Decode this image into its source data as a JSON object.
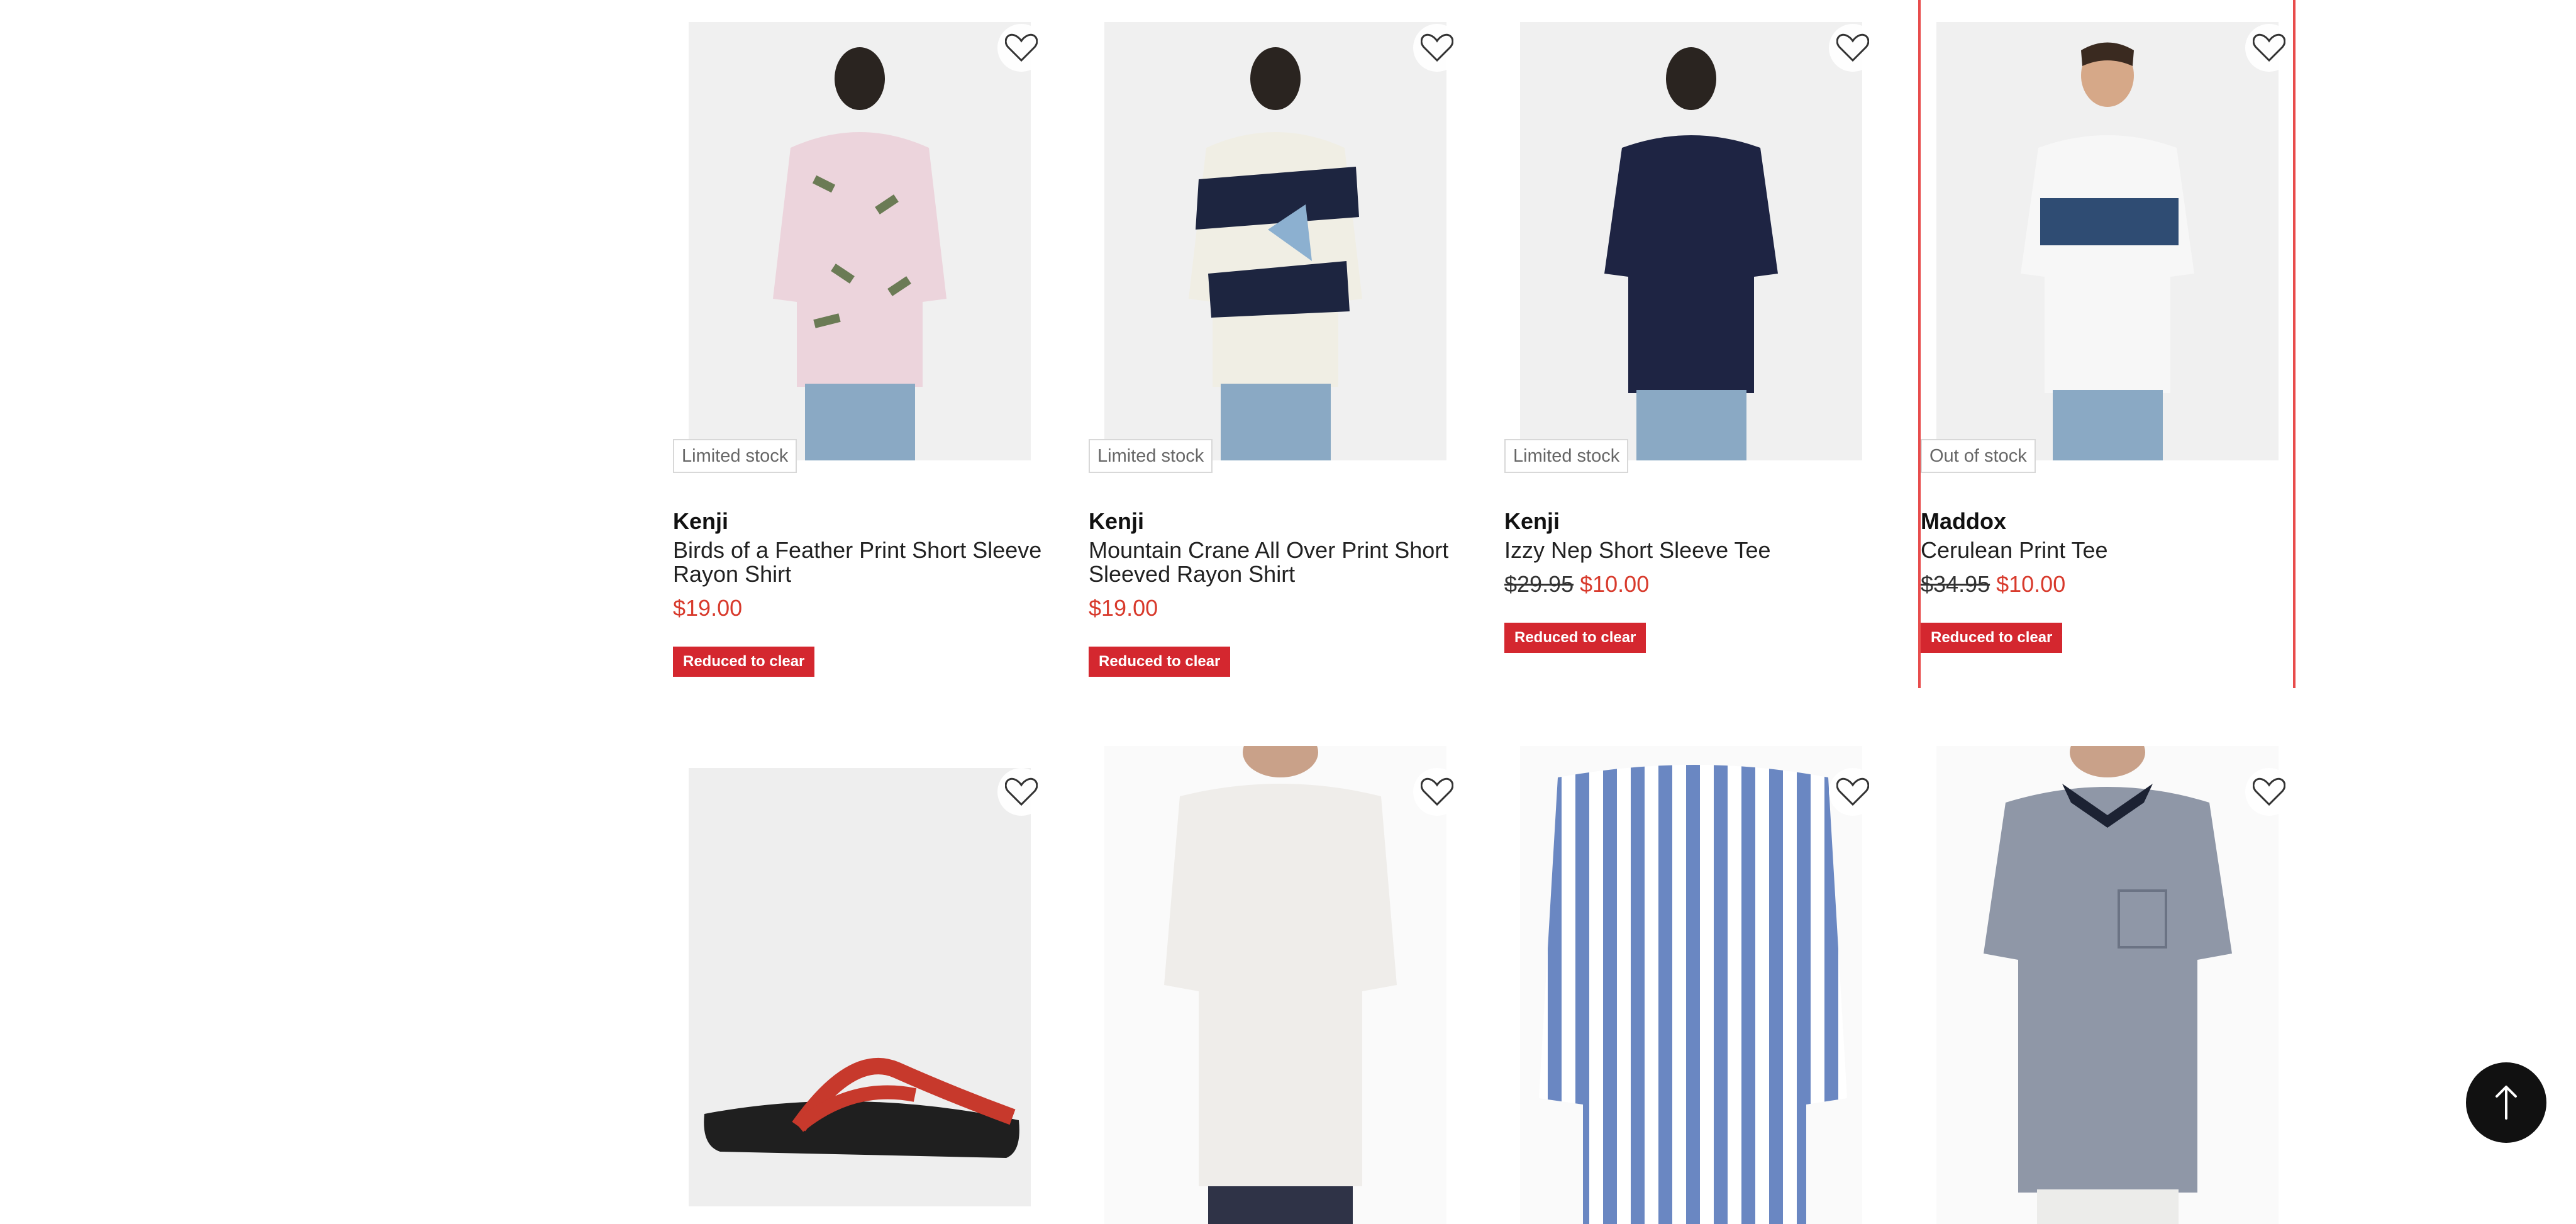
{
  "products": [
    {
      "brand": "Kenji",
      "title": "Birds of a Feather Print Short Sleeve Rayon Shirt",
      "price": "$19.00",
      "stock": "Limited stock",
      "badge": "Reduced to clear",
      "wishlist_icon": "heart-outline-icon"
    },
    {
      "brand": "Kenji",
      "title": "Mountain Crane All Over Print Short Sleeved Rayon Shirt",
      "price": "$19.00",
      "stock": "Limited stock",
      "badge": "Reduced to clear",
      "wishlist_icon": "heart-outline-icon"
    },
    {
      "brand": "Kenji",
      "title": "Izzy Nep Short Sleeve Tee",
      "was_price": "$29.95",
      "price": "$10.00",
      "stock": "Limited stock",
      "badge": "Reduced to clear",
      "wishlist_icon": "heart-outline-icon"
    },
    {
      "brand": "Maddox",
      "title": "Cerulean Print Tee",
      "was_price": "$34.95",
      "price": "$10.00",
      "stock": "Out of stock",
      "badge": "Reduced to clear",
      "wishlist_icon": "heart-outline-icon"
    }
  ],
  "row2_products": [
    {
      "wishlist_icon": "heart-outline-icon"
    },
    {
      "wishlist_icon": "heart-outline-icon"
    },
    {
      "wishlist_icon": "heart-outline-icon"
    },
    {
      "wishlist_icon": "heart-outline-icon"
    }
  ],
  "colors": {
    "accent_red": "#d4272f",
    "sale_price": "#d83a2c",
    "selection_outline": "#e84c4c"
  },
  "back_to_top_icon": "arrow-up-icon"
}
